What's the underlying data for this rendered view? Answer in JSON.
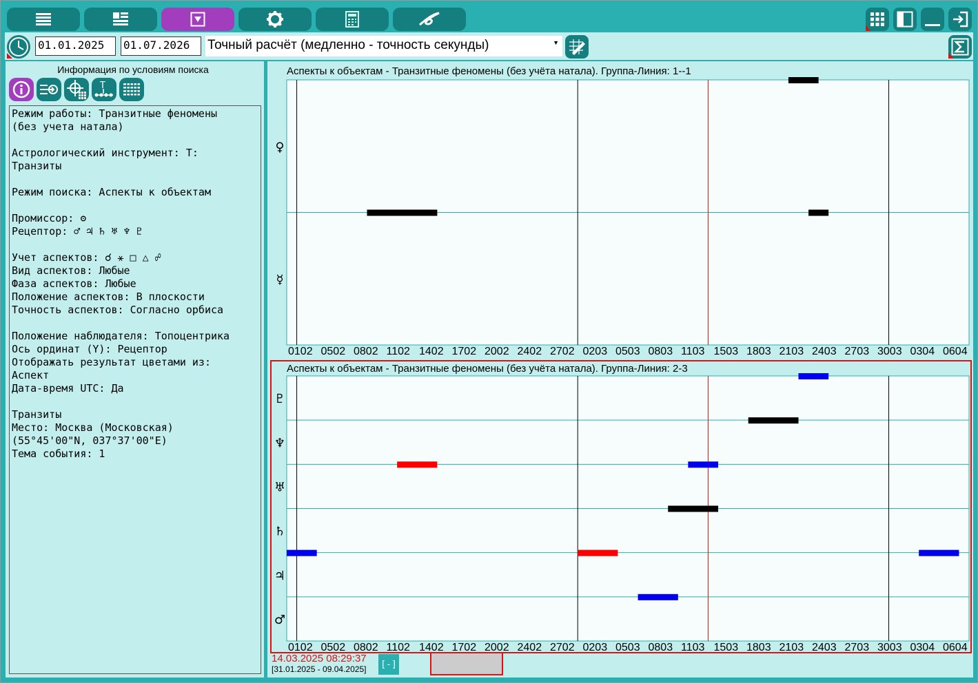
{
  "toolbar": {
    "buttons": [
      "list-icon",
      "panels-icon",
      "filter-icon",
      "gear-icon",
      "calculator-icon",
      "swirl-icon"
    ],
    "right_buttons": [
      "grid-icon",
      "sidebar-icon",
      "minimize-icon",
      "exit-icon"
    ]
  },
  "controls": {
    "date_from": "01.01.2025",
    "date_to": "01.07.2026",
    "calc_mode": "Точный расчёт (медленно - точность секунды)"
  },
  "left_panel": {
    "title": "Информация по условиям поиска",
    "tool_buttons": [
      "info-icon",
      "export-icon",
      "target-grid-icon",
      "timeline-icon",
      "keyboard-icon"
    ],
    "info_text": "Режим работы: Транзитные феномены\n(без учета натала)\n\nАстрологический инструмент: Т:\nТранзиты\n\nРежим поиска: Аспекты к объектам\n\nПромиссор: ʘ\nРецептор: ♂ ♃ ♄ ♅ ♆ ♇\n\nУчет аспектов: ☌ ⚹ □ △ ☍\nВид аспектов: Любые\nФаза аспектов: Любые\nПоложение аспектов: В плоскости\nТочность аспектов: Согласно орбиса\n\nПоложение наблюдателя: Топоцентрика\nОсь ординат (Y): Рецептор\nОтображать результат цветами из:\nАспект\nДата-время UTC: Да\n\nТранзиты\nМесто: Москва (Московская)\n(55°45'00\"N, 037°37'00\"E)\nТема события: 1"
  },
  "status": {
    "cursor_datetime": "14.03.2025 08:29:37",
    "visible_range": "[31.01.2025 - 09.04.2025]",
    "collapse_label": "[-]"
  },
  "chart_data": [
    {
      "type": "timeline",
      "title": "Аспекты к объектам - Транзитные феномены (без учёта натала). Группа-Линия: 1--1",
      "x_ticks": [
        "0102",
        "0502",
        "0802",
        "1102",
        "1402",
        "1702",
        "2002",
        "2402",
        "2702",
        "0203",
        "0503",
        "0803",
        "1103",
        "1503",
        "1803",
        "2103",
        "2403",
        "2703",
        "3003",
        "0304",
        "0604"
      ],
      "x_range_days": [
        "31.01.2025",
        "09.04.2025"
      ],
      "cursor_day": "14.03.2025",
      "rows": [
        "♀",
        "☿"
      ],
      "bars": [
        {
          "row": 0,
          "start": "22.03.2025",
          "end": "25.03.2025",
          "color": "#000000"
        },
        {
          "row": 1,
          "start": "08.02.2025",
          "end": "15.02.2025",
          "color": "#000000"
        },
        {
          "row": 1,
          "start": "24.03.2025",
          "end": "26.03.2025",
          "color": "#000000"
        }
      ]
    },
    {
      "type": "timeline",
      "title": "Аспекты к объектам - Транзитные феномены (без учёта натала). Группа-Линия: 2-3",
      "x_ticks": [
        "0102",
        "0502",
        "0802",
        "1102",
        "1402",
        "1702",
        "2002",
        "2402",
        "2702",
        "0203",
        "0503",
        "0803",
        "1103",
        "1503",
        "1803",
        "2103",
        "2403",
        "2703",
        "3003",
        "0304",
        "0604"
      ],
      "x_range_days": [
        "31.01.2025",
        "09.04.2025"
      ],
      "cursor_day": "14.03.2025",
      "rows": [
        "♇",
        "♆",
        "♅",
        "♄",
        "♃",
        "♂"
      ],
      "bars": [
        {
          "row": 0,
          "start": "23.03.2025",
          "end": "26.03.2025",
          "color": "#0000ee"
        },
        {
          "row": 1,
          "start": "18.03.2025",
          "end": "23.03.2025",
          "color": "#000000"
        },
        {
          "row": 2,
          "start": "11.02.2025",
          "end": "15.02.2025",
          "color": "#ff0000"
        },
        {
          "row": 2,
          "start": "12.03.2025",
          "end": "15.03.2025",
          "color": "#0000ee"
        },
        {
          "row": 3,
          "start": "10.03.2025",
          "end": "15.03.2025",
          "color": "#000000"
        },
        {
          "row": 4,
          "start": "31.01.2025",
          "end": "03.02.2025",
          "color": "#0000ee"
        },
        {
          "row": 4,
          "start": "01.03.2025",
          "end": "05.03.2025",
          "color": "#ff0000"
        },
        {
          "row": 4,
          "start": "04.04.2025",
          "end": "08.04.2025",
          "color": "#0000ee"
        },
        {
          "row": 5,
          "start": "07.03.2025",
          "end": "11.03.2025",
          "color": "#0000ee"
        }
      ]
    }
  ]
}
